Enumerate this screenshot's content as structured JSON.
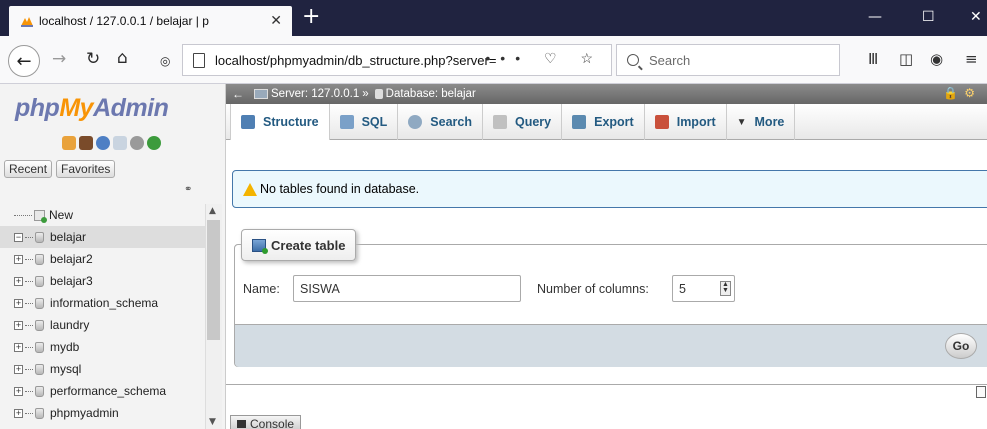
{
  "browser": {
    "tab_title": "localhost / 127.0.0.1 / belajar | p",
    "new_tab": "+",
    "url": "localhost/phpmyadmin/db_structure.php?server=",
    "url_actions": "••• ♡ ☆",
    "search_placeholder": "Search"
  },
  "logo": {
    "php": "php",
    "my": "My",
    "admin": "Admin"
  },
  "nav": {
    "recent": "Recent",
    "favorites": "Favorites",
    "new": "New",
    "databases": [
      "belajar",
      "belajar2",
      "belajar3",
      "information_schema",
      "laundry",
      "mydb",
      "mysql",
      "performance_schema",
      "phpmyadmin"
    ],
    "selected": "belajar"
  },
  "breadcrumb": {
    "server": "Server: 127.0.0.1",
    "separator": "»",
    "database": "Database: belajar"
  },
  "tabs": [
    {
      "label": "Structure",
      "active": true,
      "color": "#4f7fb3"
    },
    {
      "label": "SQL",
      "color": "#7aa0c8"
    },
    {
      "label": "Search",
      "color": "#8fa9c2"
    },
    {
      "label": "Query",
      "color": "#c0c0c0"
    },
    {
      "label": "Export",
      "color": "#5b8ab0"
    },
    {
      "label": "Import",
      "color": "#c9503b"
    },
    {
      "label": "More",
      "color": "#333333"
    }
  ],
  "notice": "No tables found in database.",
  "create_table": {
    "legend": "Create table",
    "name_label": "Name:",
    "name_value": "SISWA",
    "columns_label": "Number of columns:",
    "columns_value": "5",
    "go": "Go"
  },
  "console": "Console"
}
